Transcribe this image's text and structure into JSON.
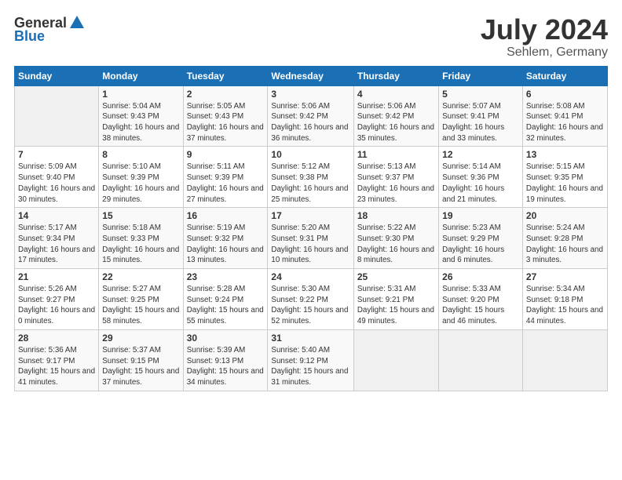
{
  "header": {
    "logo_general": "General",
    "logo_blue": "Blue",
    "month": "July 2024",
    "location": "Sehlem, Germany"
  },
  "weekdays": [
    "Sunday",
    "Monday",
    "Tuesday",
    "Wednesday",
    "Thursday",
    "Friday",
    "Saturday"
  ],
  "weeks": [
    [
      {
        "day": "",
        "sunrise": "",
        "sunset": "",
        "daylight": ""
      },
      {
        "day": "1",
        "sunrise": "Sunrise: 5:04 AM",
        "sunset": "Sunset: 9:43 PM",
        "daylight": "Daylight: 16 hours and 38 minutes."
      },
      {
        "day": "2",
        "sunrise": "Sunrise: 5:05 AM",
        "sunset": "Sunset: 9:43 PM",
        "daylight": "Daylight: 16 hours and 37 minutes."
      },
      {
        "day": "3",
        "sunrise": "Sunrise: 5:06 AM",
        "sunset": "Sunset: 9:42 PM",
        "daylight": "Daylight: 16 hours and 36 minutes."
      },
      {
        "day": "4",
        "sunrise": "Sunrise: 5:06 AM",
        "sunset": "Sunset: 9:42 PM",
        "daylight": "Daylight: 16 hours and 35 minutes."
      },
      {
        "day": "5",
        "sunrise": "Sunrise: 5:07 AM",
        "sunset": "Sunset: 9:41 PM",
        "daylight": "Daylight: 16 hours and 33 minutes."
      },
      {
        "day": "6",
        "sunrise": "Sunrise: 5:08 AM",
        "sunset": "Sunset: 9:41 PM",
        "daylight": "Daylight: 16 hours and 32 minutes."
      }
    ],
    [
      {
        "day": "7",
        "sunrise": "Sunrise: 5:09 AM",
        "sunset": "Sunset: 9:40 PM",
        "daylight": "Daylight: 16 hours and 30 minutes."
      },
      {
        "day": "8",
        "sunrise": "Sunrise: 5:10 AM",
        "sunset": "Sunset: 9:39 PM",
        "daylight": "Daylight: 16 hours and 29 minutes."
      },
      {
        "day": "9",
        "sunrise": "Sunrise: 5:11 AM",
        "sunset": "Sunset: 9:39 PM",
        "daylight": "Daylight: 16 hours and 27 minutes."
      },
      {
        "day": "10",
        "sunrise": "Sunrise: 5:12 AM",
        "sunset": "Sunset: 9:38 PM",
        "daylight": "Daylight: 16 hours and 25 minutes."
      },
      {
        "day": "11",
        "sunrise": "Sunrise: 5:13 AM",
        "sunset": "Sunset: 9:37 PM",
        "daylight": "Daylight: 16 hours and 23 minutes."
      },
      {
        "day": "12",
        "sunrise": "Sunrise: 5:14 AM",
        "sunset": "Sunset: 9:36 PM",
        "daylight": "Daylight: 16 hours and 21 minutes."
      },
      {
        "day": "13",
        "sunrise": "Sunrise: 5:15 AM",
        "sunset": "Sunset: 9:35 PM",
        "daylight": "Daylight: 16 hours and 19 minutes."
      }
    ],
    [
      {
        "day": "14",
        "sunrise": "Sunrise: 5:17 AM",
        "sunset": "Sunset: 9:34 PM",
        "daylight": "Daylight: 16 hours and 17 minutes."
      },
      {
        "day": "15",
        "sunrise": "Sunrise: 5:18 AM",
        "sunset": "Sunset: 9:33 PM",
        "daylight": "Daylight: 16 hours and 15 minutes."
      },
      {
        "day": "16",
        "sunrise": "Sunrise: 5:19 AM",
        "sunset": "Sunset: 9:32 PM",
        "daylight": "Daylight: 16 hours and 13 minutes."
      },
      {
        "day": "17",
        "sunrise": "Sunrise: 5:20 AM",
        "sunset": "Sunset: 9:31 PM",
        "daylight": "Daylight: 16 hours and 10 minutes."
      },
      {
        "day": "18",
        "sunrise": "Sunrise: 5:22 AM",
        "sunset": "Sunset: 9:30 PM",
        "daylight": "Daylight: 16 hours and 8 minutes."
      },
      {
        "day": "19",
        "sunrise": "Sunrise: 5:23 AM",
        "sunset": "Sunset: 9:29 PM",
        "daylight": "Daylight: 16 hours and 6 minutes."
      },
      {
        "day": "20",
        "sunrise": "Sunrise: 5:24 AM",
        "sunset": "Sunset: 9:28 PM",
        "daylight": "Daylight: 16 hours and 3 minutes."
      }
    ],
    [
      {
        "day": "21",
        "sunrise": "Sunrise: 5:26 AM",
        "sunset": "Sunset: 9:27 PM",
        "daylight": "Daylight: 16 hours and 0 minutes."
      },
      {
        "day": "22",
        "sunrise": "Sunrise: 5:27 AM",
        "sunset": "Sunset: 9:25 PM",
        "daylight": "Daylight: 15 hours and 58 minutes."
      },
      {
        "day": "23",
        "sunrise": "Sunrise: 5:28 AM",
        "sunset": "Sunset: 9:24 PM",
        "daylight": "Daylight: 15 hours and 55 minutes."
      },
      {
        "day": "24",
        "sunrise": "Sunrise: 5:30 AM",
        "sunset": "Sunset: 9:22 PM",
        "daylight": "Daylight: 15 hours and 52 minutes."
      },
      {
        "day": "25",
        "sunrise": "Sunrise: 5:31 AM",
        "sunset": "Sunset: 9:21 PM",
        "daylight": "Daylight: 15 hours and 49 minutes."
      },
      {
        "day": "26",
        "sunrise": "Sunrise: 5:33 AM",
        "sunset": "Sunset: 9:20 PM",
        "daylight": "Daylight: 15 hours and 46 minutes."
      },
      {
        "day": "27",
        "sunrise": "Sunrise: 5:34 AM",
        "sunset": "Sunset: 9:18 PM",
        "daylight": "Daylight: 15 hours and 44 minutes."
      }
    ],
    [
      {
        "day": "28",
        "sunrise": "Sunrise: 5:36 AM",
        "sunset": "Sunset: 9:17 PM",
        "daylight": "Daylight: 15 hours and 41 minutes."
      },
      {
        "day": "29",
        "sunrise": "Sunrise: 5:37 AM",
        "sunset": "Sunset: 9:15 PM",
        "daylight": "Daylight: 15 hours and 37 minutes."
      },
      {
        "day": "30",
        "sunrise": "Sunrise: 5:39 AM",
        "sunset": "Sunset: 9:13 PM",
        "daylight": "Daylight: 15 hours and 34 minutes."
      },
      {
        "day": "31",
        "sunrise": "Sunrise: 5:40 AM",
        "sunset": "Sunset: 9:12 PM",
        "daylight": "Daylight: 15 hours and 31 minutes."
      },
      {
        "day": "",
        "sunrise": "",
        "sunset": "",
        "daylight": ""
      },
      {
        "day": "",
        "sunrise": "",
        "sunset": "",
        "daylight": ""
      },
      {
        "day": "",
        "sunrise": "",
        "sunset": "",
        "daylight": ""
      }
    ]
  ]
}
